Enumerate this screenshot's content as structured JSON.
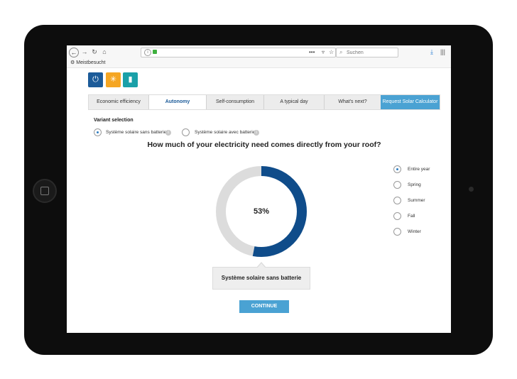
{
  "browser": {
    "url": "",
    "search_placeholder": "Suchen",
    "bookmarks_label": "Meistbesucht"
  },
  "product_icons": [
    {
      "name": "plug-icon",
      "color": "#1c5b99"
    },
    {
      "name": "sun-icon",
      "color": "#f5a623"
    },
    {
      "name": "battery-icon",
      "color": "#1aa0a8"
    }
  ],
  "steps": [
    {
      "label": "Economic efficiency",
      "state": "done"
    },
    {
      "label": "Autonomy",
      "state": "active"
    },
    {
      "label": "Self-consumption",
      "state": "todo"
    },
    {
      "label": "A typical day",
      "state": "todo"
    },
    {
      "label": "What's next?",
      "state": "todo"
    },
    {
      "label": "Request Solar Calculator",
      "state": "request"
    }
  ],
  "variant": {
    "title": "Variant selection",
    "options": [
      {
        "label": "Système solaire sans batterie",
        "selected": true
      },
      {
        "label": "Système solaire avec batterie",
        "selected": false
      }
    ]
  },
  "question": "How much of your electricity need comes directly from your roof?",
  "chart": {
    "percent_label": "53%",
    "percent_value": 53,
    "fill_color": "#0f4c8a",
    "track_color": "#dcdcdc"
  },
  "seasons": [
    {
      "label": "Entire year",
      "selected": true
    },
    {
      "label": "Spring",
      "selected": false
    },
    {
      "label": "Summer",
      "selected": false
    },
    {
      "label": "Fall",
      "selected": false
    },
    {
      "label": "Winter",
      "selected": false
    }
  ],
  "tooltip_label": "Système solaire sans batterie",
  "continue_label": "CONTINUE"
}
